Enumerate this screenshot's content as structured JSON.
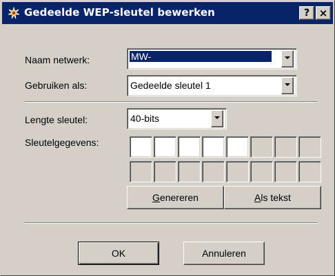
{
  "window": {
    "title": "Gedeelde WEP-sleutel bewerken",
    "help_label": "?",
    "close_label": "×"
  },
  "network": {
    "label": "Naam netwerk:",
    "value": "MW-"
  },
  "use_as": {
    "label": "Gebruiken als:",
    "value": "Gedeelde sleutel 1"
  },
  "key_length": {
    "label": "Lengte sleutel:",
    "value": "40-bits"
  },
  "key_data": {
    "label": "Sleutelgegevens:",
    "enabled_cells": 5,
    "total_cells": 16
  },
  "buttons": {
    "generate_mnemonic": "G",
    "generate_rest": "enereren",
    "as_text_mnemonic": "A",
    "as_text_rest": "ls tekst",
    "ok": "OK",
    "cancel": "Annuleren"
  },
  "colors": {
    "titlebar": "#0a246a",
    "face": "#d4d0c8",
    "selection": "#0a246a"
  },
  "icons": {
    "title": "wep-key-icon",
    "combo_arrow": "chevron-down-icon"
  }
}
